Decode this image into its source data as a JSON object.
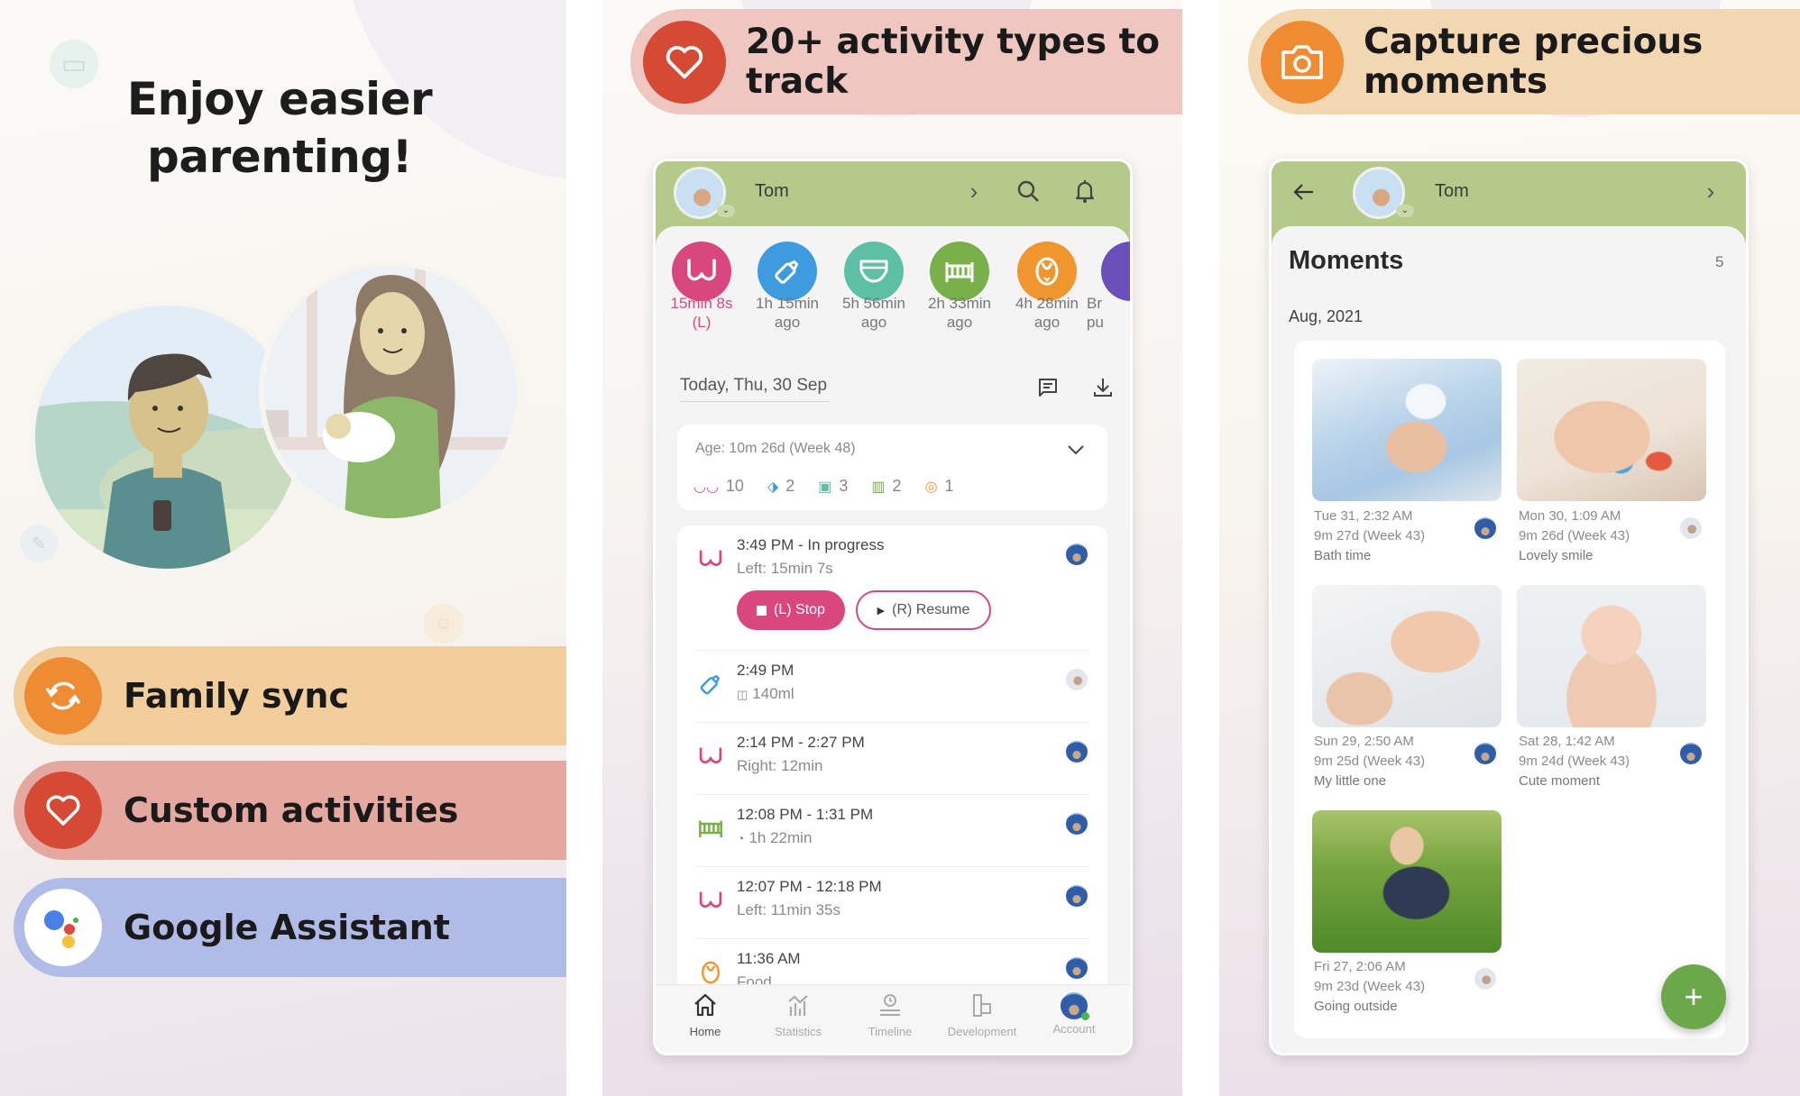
{
  "panels": {
    "left": {
      "headline_line1": "Enjoy easier",
      "headline_line2": "parenting!",
      "features": [
        {
          "label": "Family sync",
          "icon": "sync-icon",
          "color": "#ef8b32",
          "bg": "#f2ce9c"
        },
        {
          "label": "Custom activities",
          "icon": "heart-icon",
          "color": "#d54a35",
          "bg": "#e5a8a1"
        },
        {
          "label": "Google Assistant",
          "icon": "google-assistant-icon",
          "color": "#ffffff",
          "bg": "#b0bbe8"
        }
      ]
    },
    "middle": {
      "headline_line1": "20+ activity types to",
      "headline_line2": "track",
      "headline_icon": "heart-icon",
      "headline_color": "#d54a35",
      "app": {
        "child_name": "Tom",
        "activities": [
          {
            "name": "breastfeeding",
            "line1": "15min 8s",
            "line2": "(L)",
            "color": "#d94680",
            "active": true
          },
          {
            "name": "bottle",
            "line1": "1h 15min",
            "line2": "ago",
            "color": "#3f9bdf"
          },
          {
            "name": "diaper",
            "line1": "5h 56min",
            "line2": "ago",
            "color": "#5dbfa5"
          },
          {
            "name": "sleep",
            "line1": "2h 33min",
            "line2": "ago",
            "color": "#79b049"
          },
          {
            "name": "food",
            "line1": "4h 28min",
            "line2": "ago",
            "color": "#f0962e"
          },
          {
            "name": "partial",
            "line1": "Br",
            "line2": "pu",
            "color": "#6a4fb8"
          }
        ],
        "date_label": "Today, Thu, 30 Sep",
        "summary": {
          "age": "Age: 10m 26d (Week 48)",
          "counts": [
            {
              "type": "breastfeeding",
              "count": "10"
            },
            {
              "type": "bottle",
              "count": "2"
            },
            {
              "type": "diaper",
              "count": "3"
            },
            {
              "type": "sleep",
              "count": "2"
            },
            {
              "type": "food",
              "count": "1"
            }
          ]
        },
        "timeline": [
          {
            "type": "breastfeeding",
            "time": "3:49 PM - In progress",
            "detail": "Left: 15min 7s",
            "by": "blue"
          },
          {
            "type": "bottle",
            "time": "2:49 PM",
            "detail": "140ml",
            "by": "photo"
          },
          {
            "type": "breastfeeding",
            "time": "2:14 PM - 2:27 PM",
            "detail": "Right: 12min",
            "by": "blue"
          },
          {
            "type": "sleep",
            "time": "12:08 PM - 1:31 PM",
            "detail": "1h 22min",
            "by": "blue"
          },
          {
            "type": "breastfeeding",
            "time": "12:07 PM - 12:18 PM",
            "detail": "Left: 11min 35s",
            "by": "blue"
          },
          {
            "type": "food",
            "time": "11:36 AM",
            "detail": "Food",
            "by": "blue"
          }
        ],
        "stop_button": "(L) Stop",
        "resume_button": "(R) Resume",
        "nav": [
          {
            "label": "Home",
            "active": true
          },
          {
            "label": "Statistics"
          },
          {
            "label": "Timeline"
          },
          {
            "label": "Development"
          },
          {
            "label": "Account"
          }
        ]
      }
    },
    "right": {
      "headline_line1": "Capture precious",
      "headline_line2": "moments",
      "headline_icon": "camera-icon",
      "headline_color": "#ef8b32",
      "app": {
        "child_name": "Tom",
        "title": "Moments",
        "count": "5",
        "month": "Aug, 2021",
        "moments": [
          {
            "date": "Tue 31, 2:32 AM",
            "age": "9m 27d (Week 43)",
            "caption": "Bath time",
            "by": "blue"
          },
          {
            "date": "Mon 30, 1:09 AM",
            "age": "9m 26d (Week 43)",
            "caption": "Lovely smile",
            "by": "photo"
          },
          {
            "date": "Sun 29, 2:50 AM",
            "age": "9m 25d (Week 43)",
            "caption": "My little one",
            "by": "blue"
          },
          {
            "date": "Sat 28, 1:42 AM",
            "age": "9m 24d (Week 43)",
            "caption": "Cute moment",
            "by": "blue"
          },
          {
            "date": "Fri 27, 2:06 AM",
            "age": "9m 23d (Week 43)",
            "caption": "Going outside",
            "by": "photo"
          }
        ],
        "fab_label": "+"
      }
    }
  },
  "colors": {
    "appbar_green": "#b5c98a",
    "fab_green": "#6ca84a",
    "breastfeeding_pink": "#d94680"
  }
}
